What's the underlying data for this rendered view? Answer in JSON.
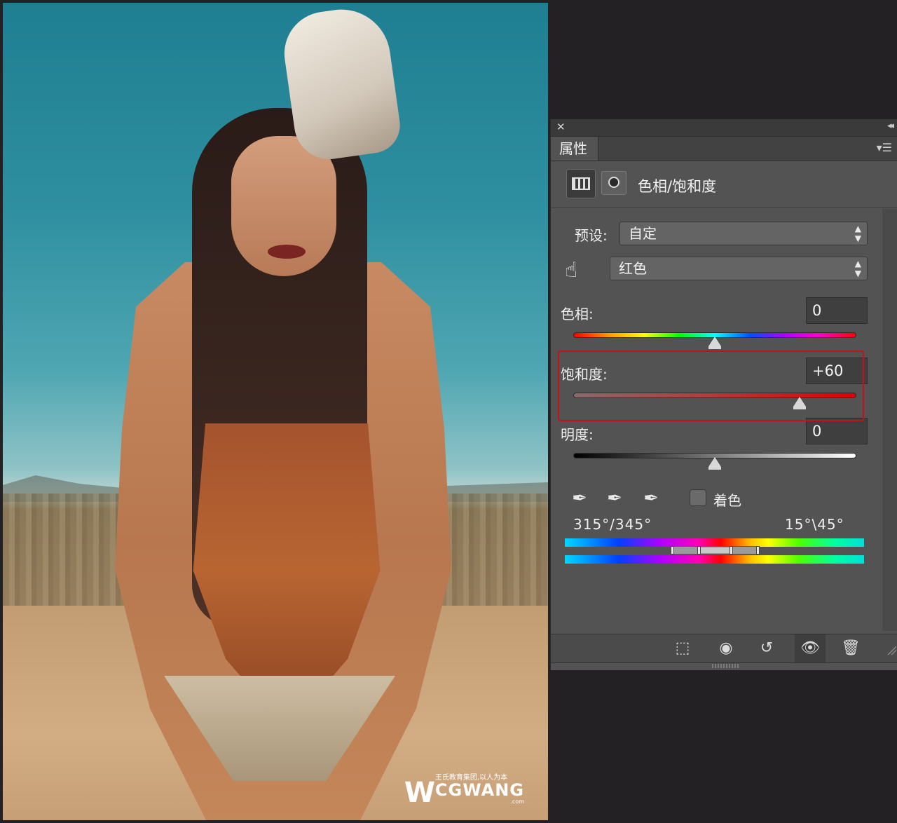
{
  "panel": {
    "tab_label": "属性",
    "close_glyph": "✕",
    "collapse_glyph": "◂◂",
    "menu_glyph": "▾☰",
    "adjustment_title": "色相/饱和度",
    "adjustment_icon": "hue-saturation-icon",
    "mask_icon": "layer-mask-icon"
  },
  "preset": {
    "label": "预设:",
    "value": "自定"
  },
  "channel": {
    "value": "红色",
    "tool_icon": "targeted-adjustment-hand-icon"
  },
  "hue": {
    "label": "色相:",
    "value": "0",
    "position": 0.5
  },
  "saturation": {
    "label": "饱和度:",
    "value": "+60",
    "position": 0.8
  },
  "lightness": {
    "label": "明度:",
    "value": "0",
    "position": 0.5
  },
  "colorize": {
    "label": "着色",
    "checked": false
  },
  "eyedroppers": [
    "eyedropper-icon",
    "eyedropper-add-icon",
    "eyedropper-subtract-icon"
  ],
  "range": {
    "left": "315°/345°",
    "right": "15°\\45°"
  },
  "footer": {
    "buttons": [
      "clip-to-layer-icon",
      "view-previous-state-icon",
      "reset-icon",
      "visibility-icon",
      "delete-icon"
    ]
  },
  "watermark": {
    "logo": "W",
    "tagline": "王氏教育集团,以人为本",
    "brand": "CGWANG",
    "domain": ".com"
  },
  "colors": {
    "panel_bg": "#535353",
    "highlight": "#c4121a",
    "background": "#232124"
  }
}
